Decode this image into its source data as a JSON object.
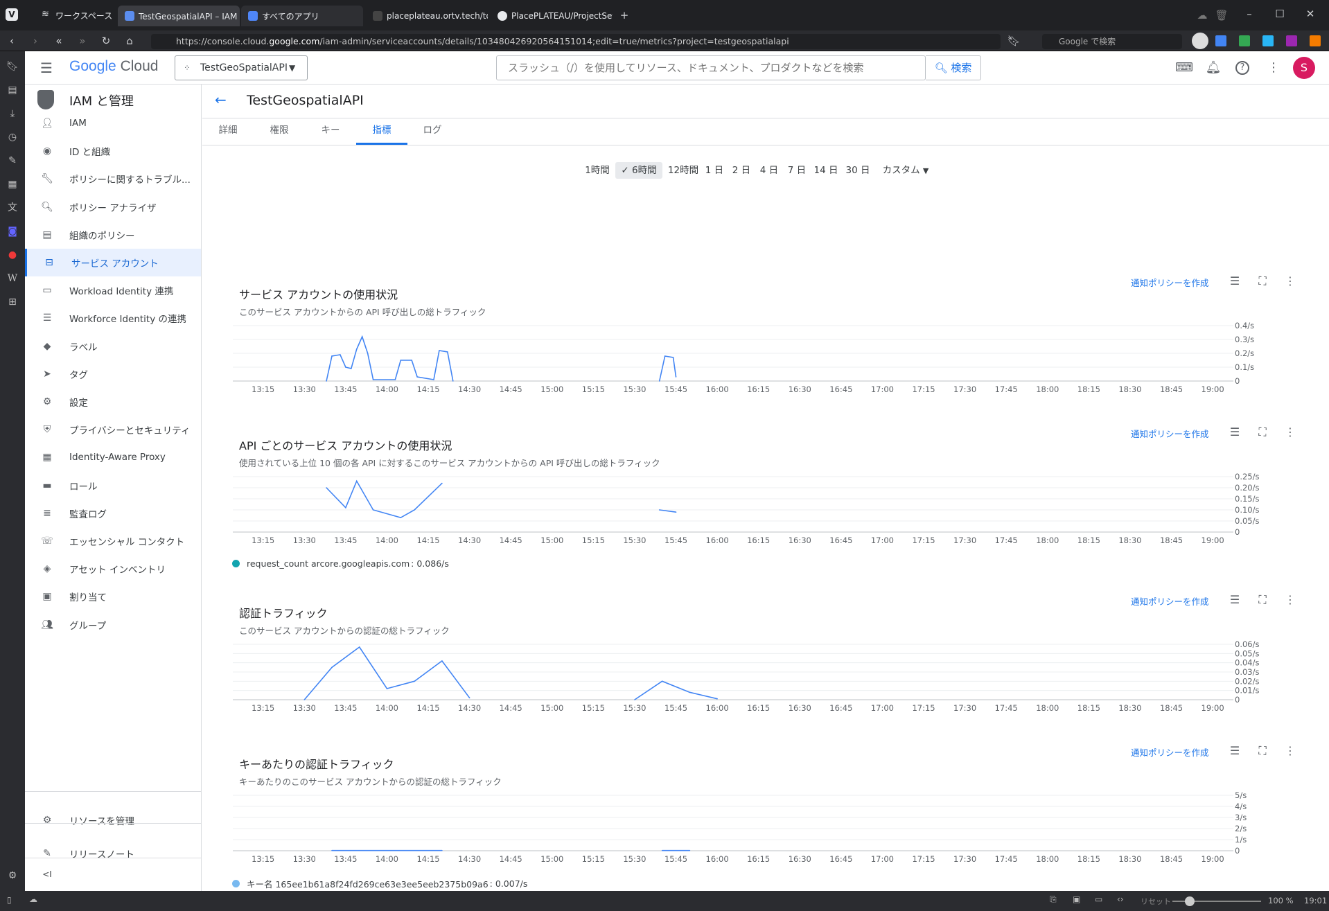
{
  "browser": {
    "workspace_label": "ワークスペース",
    "tabs": [
      {
        "label": "TestGeospatialAPI – IAM と管理",
        "active": true
      },
      {
        "label": "すべてのアプリ",
        "active": false
      },
      {
        "label": "placeplateau.ortv.tech/token",
        "active": false
      },
      {
        "label": "PlacePLATEAU/ProjectSettings",
        "active": false
      }
    ],
    "url_prefix": "https://console.cloud.",
    "url_host": "google.com",
    "url_rest": "/iam-admin/serviceaccounts/details/103480426920564151014;edit=true/metrics?project=testgeospatialapi",
    "search_placeholder": "Google で検索",
    "status": {
      "reset": "リセット",
      "zoom": "100 %",
      "time": "19:01"
    }
  },
  "header": {
    "logo_google": "Google",
    "logo_cloud": "Cloud",
    "project": "TestGeoSpatialAPI",
    "search_placeholder": "スラッシュ（/）を使用してリソース、ドキュメント、プロダクトなどを検索",
    "search_button": "検索",
    "avatar_letter": "S"
  },
  "nav": {
    "title": "IAM と管理",
    "items": [
      {
        "label": "IAM",
        "icon": "person-add-icon"
      },
      {
        "label": "ID と組織",
        "icon": "account-circle-icon"
      },
      {
        "label": "ポリシーに関するトラブル...",
        "icon": "wrench-icon"
      },
      {
        "label": "ポリシー アナライザ",
        "icon": "policy-analyzer-icon"
      },
      {
        "label": "組織のポリシー",
        "icon": "document-icon"
      },
      {
        "label": "サービス アカウント",
        "icon": "service-account-icon",
        "active": true
      },
      {
        "label": "Workload Identity 連携",
        "icon": "id-card-icon"
      },
      {
        "label": "Workforce Identity の連携",
        "icon": "list-icon"
      },
      {
        "label": "ラベル",
        "icon": "label-icon"
      },
      {
        "label": "タグ",
        "icon": "tag-icon"
      },
      {
        "label": "設定",
        "icon": "gear-icon"
      },
      {
        "label": "プライバシーとセキュリティ",
        "icon": "shield-icon"
      },
      {
        "label": "Identity-Aware Proxy",
        "icon": "proxy-icon"
      },
      {
        "label": "ロール",
        "icon": "roles-icon"
      },
      {
        "label": "監査ログ",
        "icon": "audit-log-icon"
      },
      {
        "label": "エッセンシャル コンタクト",
        "icon": "contacts-icon"
      },
      {
        "label": "アセット インベントリ",
        "icon": "asset-icon"
      },
      {
        "label": "割り当て",
        "icon": "quota-icon"
      },
      {
        "label": "グループ",
        "icon": "group-icon"
      }
    ],
    "footer": {
      "manage_resources": "リソースを管理",
      "release_notes": "リリースノート",
      "collapse": "<I"
    }
  },
  "page": {
    "title": "TestGeospatialAPI",
    "tabs": [
      "詳細",
      "権限",
      "キー",
      "指標",
      "ログ"
    ],
    "active_tab": "指標",
    "time_ranges": [
      "1時間",
      "6時間",
      "12時間",
      "1 日",
      "2 日",
      "4 日",
      "7 日",
      "14 日",
      "30 日",
      "カスタム"
    ],
    "active_time_range": "6時間",
    "create_policy_label": "通知ポリシーを作成"
  },
  "colors": {
    "accent": "#1a73e8",
    "series_blue": "#4285f4",
    "legend_teal": "#12a4af",
    "legend_lightblue": "#78b9f0"
  },
  "chart_data": [
    {
      "type": "line",
      "title": "サービス アカウントの使用状況",
      "subtitle": "このサービス アカウントからの API 呼び出しの総トラフィック",
      "x": [
        "13:15",
        "13:30",
        "13:45",
        "14:00",
        "14:15",
        "14:30",
        "14:45",
        "15:00",
        "15:15",
        "15:30",
        "15:45",
        "16:00",
        "16:15",
        "16:30",
        "16:45",
        "17:00",
        "17:15",
        "17:30",
        "17:45",
        "18:00",
        "18:15",
        "18:30",
        "18:45",
        "19:00"
      ],
      "y_ticks": [
        "0.4/s",
        "0.3/s",
        "0.2/s",
        "0.1/s",
        "0"
      ],
      "ylim": [
        0,
        0.4
      ],
      "segments": [
        [
          [
            "13:38",
            0
          ],
          [
            "13:40",
            0.18
          ],
          [
            "13:43",
            0.19
          ],
          [
            "13:45",
            0.1
          ],
          [
            "13:47",
            0.09
          ],
          [
            "13:49",
            0.23
          ],
          [
            "13:51",
            0.32
          ],
          [
            "13:53",
            0.2
          ],
          [
            "13:55",
            0.01
          ],
          [
            "14:03",
            0.01
          ],
          [
            "14:05",
            0.15
          ],
          [
            "14:09",
            0.15
          ],
          [
            "14:11",
            0.03
          ],
          [
            "14:17",
            0.01
          ],
          [
            "14:19",
            0.22
          ],
          [
            "14:22",
            0.21
          ],
          [
            "14:24",
            0
          ]
        ],
        [
          [
            "15:39",
            0
          ],
          [
            "15:41",
            0.18
          ],
          [
            "15:44",
            0.17
          ],
          [
            "15:45",
            0.03
          ]
        ]
      ]
    },
    {
      "type": "line",
      "title": "API ごとのサービス アカウントの使用状況",
      "subtitle": "使用されている上位 10 個の各 API に対するこのサービス アカウントからの API 呼び出しの総トラフィック",
      "x": [
        "13:15",
        "13:30",
        "13:45",
        "14:00",
        "14:15",
        "14:30",
        "14:45",
        "15:00",
        "15:15",
        "15:30",
        "15:45",
        "16:00",
        "16:15",
        "16:30",
        "16:45",
        "17:00",
        "17:15",
        "17:30",
        "17:45",
        "18:00",
        "18:15",
        "18:30",
        "18:45",
        "19:00"
      ],
      "y_ticks": [
        "0.25/s",
        "0.20/s",
        "0.15/s",
        "0.10/s",
        "0.05/s",
        "0"
      ],
      "ylim": [
        0,
        0.25
      ],
      "segments": [
        [
          [
            "13:38",
            0.2
          ],
          [
            "13:45",
            0.11
          ],
          [
            "13:49",
            0.23
          ],
          [
            "13:55",
            0.1
          ],
          [
            "14:05",
            0.065
          ],
          [
            "14:10",
            0.1
          ],
          [
            "14:20",
            0.22
          ]
        ],
        [
          [
            "15:39",
            0.1
          ],
          [
            "15:45",
            0.09
          ]
        ]
      ],
      "legend": [
        {
          "name": "request_count arcore.googleapis.com",
          "value": "0.086/s"
        }
      ]
    },
    {
      "type": "line",
      "title": "認証トラフィック",
      "subtitle": "このサービス アカウントからの認証の総トラフィック",
      "x": [
        "13:15",
        "13:30",
        "13:45",
        "14:00",
        "14:15",
        "14:30",
        "14:45",
        "15:00",
        "15:15",
        "15:30",
        "15:45",
        "16:00",
        "16:15",
        "16:30",
        "16:45",
        "17:00",
        "17:15",
        "17:30",
        "17:45",
        "18:00",
        "18:15",
        "18:30",
        "18:45",
        "19:00"
      ],
      "y_ticks": [
        "0.06/s",
        "0.05/s",
        "0.04/s",
        "0.03/s",
        "0.02/s",
        "0.01/s",
        "0"
      ],
      "ylim": [
        0,
        0.06
      ],
      "segments": [
        [
          [
            "13:30",
            0.0
          ],
          [
            "13:40",
            0.035
          ],
          [
            "13:50",
            0.057
          ],
          [
            "14:00",
            0.012
          ],
          [
            "14:10",
            0.02
          ],
          [
            "14:20",
            0.042
          ],
          [
            "14:30",
            0.002
          ]
        ],
        [
          [
            "15:30",
            0.0
          ],
          [
            "15:40",
            0.02
          ],
          [
            "15:50",
            0.008
          ],
          [
            "16:00",
            0.001
          ]
        ]
      ]
    },
    {
      "type": "line",
      "title": "キーあたりの認証トラフィック",
      "subtitle": "キーあたりのこのサービス アカウントからの認証の総トラフィック",
      "x": [
        "13:15",
        "13:30",
        "13:45",
        "14:00",
        "14:15",
        "14:30",
        "14:45",
        "15:00",
        "15:15",
        "15:30",
        "15:45",
        "16:00",
        "16:15",
        "16:30",
        "16:45",
        "17:00",
        "17:15",
        "17:30",
        "17:45",
        "18:00",
        "18:15",
        "18:30",
        "18:45",
        "19:00"
      ],
      "y_ticks": [
        "5/s",
        "4/s",
        "3/s",
        "2/s",
        "1/s",
        "0"
      ],
      "ylim": [
        0,
        5
      ],
      "segments": [
        [
          [
            "13:40",
            0.02
          ],
          [
            "14:20",
            0.02
          ]
        ],
        [
          [
            "15:40",
            0.02
          ],
          [
            "15:50",
            0.02
          ]
        ]
      ],
      "legend": [
        {
          "name": "キー名 165ee1b61a8f24fd269ce63e3ee5eeb2375b09a6",
          "value": "0.007/s"
        }
      ]
    }
  ]
}
